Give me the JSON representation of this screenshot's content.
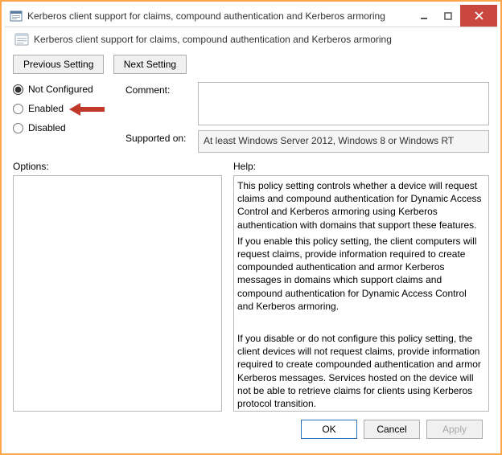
{
  "window": {
    "title": "Kerberos client support for claims, compound authentication and Kerberos armoring"
  },
  "header": {
    "policy_title": "Kerberos client support for claims, compound authentication and Kerberos armoring"
  },
  "nav": {
    "previous": "Previous Setting",
    "next": "Next Setting"
  },
  "radios": {
    "not_configured": "Not Configured",
    "enabled": "Enabled",
    "disabled": "Disabled",
    "selected": "not_configured"
  },
  "fields": {
    "comment_label": "Comment:",
    "comment_value": "",
    "supported_label": "Supported on:",
    "supported_value": "At least Windows Server 2012, Windows 8 or Windows RT"
  },
  "columns": {
    "options_label": "Options:",
    "help_label": "Help:"
  },
  "options_body": "",
  "help_body": {
    "p1": "This policy setting controls whether a device will request claims and compound authentication for Dynamic Access Control and Kerberos armoring using Kerberos authentication with domains that support these features.",
    "p2": "If you enable this policy setting, the client computers will request claims, provide information required to create compounded authentication and armor Kerberos messages in domains which support claims and compound authentication for Dynamic Access Control and Kerberos armoring.",
    "p3": "If you disable or do not configure this policy setting, the client devices will not request claims, provide information required to create compounded authentication and armor Kerberos messages. Services hosted on the device will not be able to retrieve claims for clients using Kerberos protocol transition."
  },
  "footer": {
    "ok": "OK",
    "cancel": "Cancel",
    "apply": "Apply"
  }
}
